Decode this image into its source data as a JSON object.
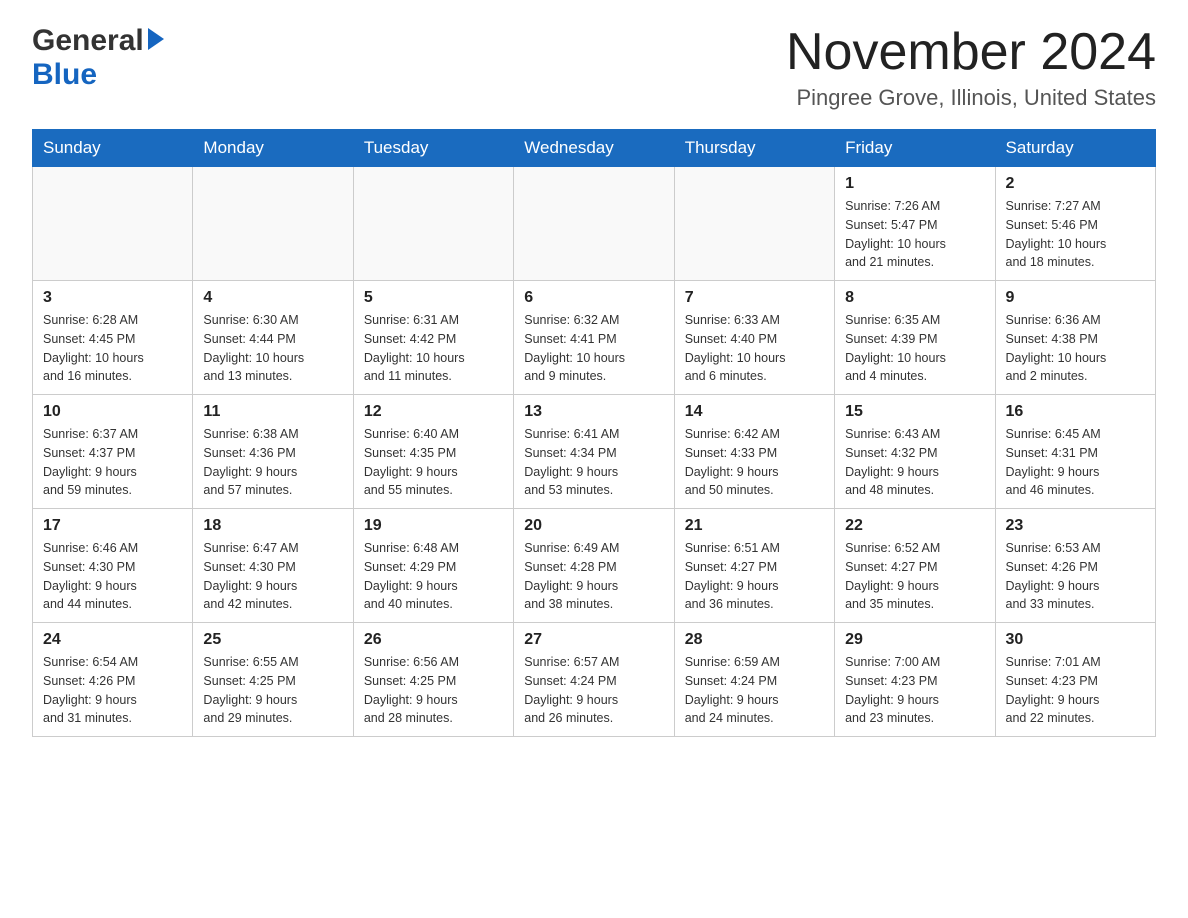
{
  "logo": {
    "general": "General",
    "blue": "Blue",
    "arrow_unicode": "▶"
  },
  "header": {
    "title": "November 2024",
    "subtitle": "Pingree Grove, Illinois, United States"
  },
  "weekdays": [
    "Sunday",
    "Monday",
    "Tuesday",
    "Wednesday",
    "Thursday",
    "Friday",
    "Saturday"
  ],
  "weeks": [
    [
      {
        "day": "",
        "info": ""
      },
      {
        "day": "",
        "info": ""
      },
      {
        "day": "",
        "info": ""
      },
      {
        "day": "",
        "info": ""
      },
      {
        "day": "",
        "info": ""
      },
      {
        "day": "1",
        "info": "Sunrise: 7:26 AM\nSunset: 5:47 PM\nDaylight: 10 hours\nand 21 minutes."
      },
      {
        "day": "2",
        "info": "Sunrise: 7:27 AM\nSunset: 5:46 PM\nDaylight: 10 hours\nand 18 minutes."
      }
    ],
    [
      {
        "day": "3",
        "info": "Sunrise: 6:28 AM\nSunset: 4:45 PM\nDaylight: 10 hours\nand 16 minutes."
      },
      {
        "day": "4",
        "info": "Sunrise: 6:30 AM\nSunset: 4:44 PM\nDaylight: 10 hours\nand 13 minutes."
      },
      {
        "day": "5",
        "info": "Sunrise: 6:31 AM\nSunset: 4:42 PM\nDaylight: 10 hours\nand 11 minutes."
      },
      {
        "day": "6",
        "info": "Sunrise: 6:32 AM\nSunset: 4:41 PM\nDaylight: 10 hours\nand 9 minutes."
      },
      {
        "day": "7",
        "info": "Sunrise: 6:33 AM\nSunset: 4:40 PM\nDaylight: 10 hours\nand 6 minutes."
      },
      {
        "day": "8",
        "info": "Sunrise: 6:35 AM\nSunset: 4:39 PM\nDaylight: 10 hours\nand 4 minutes."
      },
      {
        "day": "9",
        "info": "Sunrise: 6:36 AM\nSunset: 4:38 PM\nDaylight: 10 hours\nand 2 minutes."
      }
    ],
    [
      {
        "day": "10",
        "info": "Sunrise: 6:37 AM\nSunset: 4:37 PM\nDaylight: 9 hours\nand 59 minutes."
      },
      {
        "day": "11",
        "info": "Sunrise: 6:38 AM\nSunset: 4:36 PM\nDaylight: 9 hours\nand 57 minutes."
      },
      {
        "day": "12",
        "info": "Sunrise: 6:40 AM\nSunset: 4:35 PM\nDaylight: 9 hours\nand 55 minutes."
      },
      {
        "day": "13",
        "info": "Sunrise: 6:41 AM\nSunset: 4:34 PM\nDaylight: 9 hours\nand 53 minutes."
      },
      {
        "day": "14",
        "info": "Sunrise: 6:42 AM\nSunset: 4:33 PM\nDaylight: 9 hours\nand 50 minutes."
      },
      {
        "day": "15",
        "info": "Sunrise: 6:43 AM\nSunset: 4:32 PM\nDaylight: 9 hours\nand 48 minutes."
      },
      {
        "day": "16",
        "info": "Sunrise: 6:45 AM\nSunset: 4:31 PM\nDaylight: 9 hours\nand 46 minutes."
      }
    ],
    [
      {
        "day": "17",
        "info": "Sunrise: 6:46 AM\nSunset: 4:30 PM\nDaylight: 9 hours\nand 44 minutes."
      },
      {
        "day": "18",
        "info": "Sunrise: 6:47 AM\nSunset: 4:30 PM\nDaylight: 9 hours\nand 42 minutes."
      },
      {
        "day": "19",
        "info": "Sunrise: 6:48 AM\nSunset: 4:29 PM\nDaylight: 9 hours\nand 40 minutes."
      },
      {
        "day": "20",
        "info": "Sunrise: 6:49 AM\nSunset: 4:28 PM\nDaylight: 9 hours\nand 38 minutes."
      },
      {
        "day": "21",
        "info": "Sunrise: 6:51 AM\nSunset: 4:27 PM\nDaylight: 9 hours\nand 36 minutes."
      },
      {
        "day": "22",
        "info": "Sunrise: 6:52 AM\nSunset: 4:27 PM\nDaylight: 9 hours\nand 35 minutes."
      },
      {
        "day": "23",
        "info": "Sunrise: 6:53 AM\nSunset: 4:26 PM\nDaylight: 9 hours\nand 33 minutes."
      }
    ],
    [
      {
        "day": "24",
        "info": "Sunrise: 6:54 AM\nSunset: 4:26 PM\nDaylight: 9 hours\nand 31 minutes."
      },
      {
        "day": "25",
        "info": "Sunrise: 6:55 AM\nSunset: 4:25 PM\nDaylight: 9 hours\nand 29 minutes."
      },
      {
        "day": "26",
        "info": "Sunrise: 6:56 AM\nSunset: 4:25 PM\nDaylight: 9 hours\nand 28 minutes."
      },
      {
        "day": "27",
        "info": "Sunrise: 6:57 AM\nSunset: 4:24 PM\nDaylight: 9 hours\nand 26 minutes."
      },
      {
        "day": "28",
        "info": "Sunrise: 6:59 AM\nSunset: 4:24 PM\nDaylight: 9 hours\nand 24 minutes."
      },
      {
        "day": "29",
        "info": "Sunrise: 7:00 AM\nSunset: 4:23 PM\nDaylight: 9 hours\nand 23 minutes."
      },
      {
        "day": "30",
        "info": "Sunrise: 7:01 AM\nSunset: 4:23 PM\nDaylight: 9 hours\nand 22 minutes."
      }
    ]
  ]
}
